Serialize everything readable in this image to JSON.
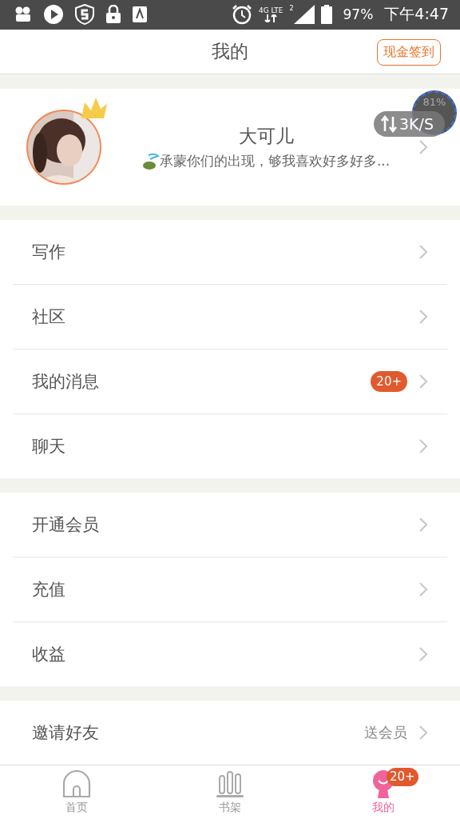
{
  "status_bar": {
    "network": "4G LTE",
    "sim": "2",
    "battery": "97%",
    "time": "下午4:47"
  },
  "header": {
    "title": "我的",
    "action": "现金签到"
  },
  "profile": {
    "name": "大可儿",
    "motto": "承蒙你们的出现，够我喜欢好多好多..."
  },
  "speed_widget": {
    "percent": "81%",
    "speed": "3K/S"
  },
  "groups": [
    [
      {
        "label": "写作"
      },
      {
        "label": "社区"
      },
      {
        "label": "我的消息",
        "badge": "20+"
      },
      {
        "label": "聊天"
      }
    ],
    [
      {
        "label": "开通会员"
      },
      {
        "label": "充值"
      },
      {
        "label": "收益"
      }
    ],
    [
      {
        "label": "邀请好友",
        "detail": "送会员"
      }
    ]
  ],
  "tabs": [
    {
      "kind": "home",
      "label": "首页",
      "selected": false
    },
    {
      "kind": "shelf",
      "label": "书架",
      "selected": false
    },
    {
      "kind": "me",
      "label": "我的",
      "selected": true,
      "badge": "20+"
    }
  ]
}
